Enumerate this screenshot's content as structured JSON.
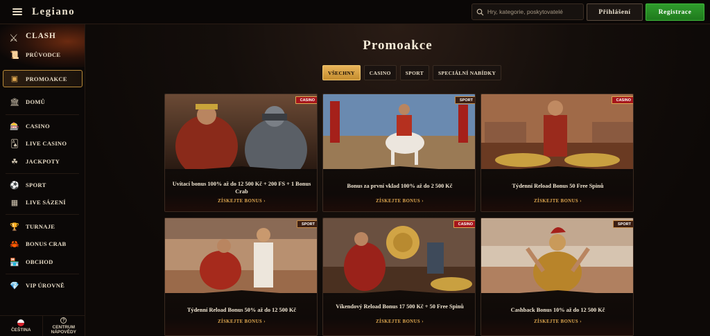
{
  "header": {
    "logo": "Legiano",
    "search_placeholder": "Hry, kategorie, poskytovatelé",
    "login_label": "Přihlášení",
    "register_label": "Registrace",
    "register_color": "#2a8f27"
  },
  "sidebar": {
    "clash_label": "CLASH",
    "items": [
      {
        "label": "PRŮVODCE",
        "icon": "scroll-icon"
      },
      {
        "label": "PROMOAKCE",
        "icon": "treasure-chest-icon",
        "active": true
      },
      {
        "label": "DOMŮ",
        "icon": "temple-icon"
      },
      {
        "label": "CASINO",
        "icon": "slot-machine-icon"
      },
      {
        "label": "LIVE CASINO",
        "icon": "cards-icon"
      },
      {
        "label": "JACKPOTY",
        "icon": "clover-icon"
      },
      {
        "label": "SPORT",
        "icon": "ball-icon"
      },
      {
        "label": "LIVE SÁZENÍ",
        "icon": "live-icon"
      },
      {
        "label": "TURNAJE",
        "icon": "trophy-icon"
      },
      {
        "label": "BONUS CRAB",
        "icon": "crab-icon"
      },
      {
        "label": "OBCHOD",
        "icon": "shop-icon"
      },
      {
        "label": "VIP ÚROVNĚ",
        "icon": "diamond-icon"
      }
    ],
    "footer": {
      "language": "ČEŠTINA",
      "help_line1": "CENTRUM",
      "help_line2": "NÁPOVĚDY"
    }
  },
  "main": {
    "title": "Promoakce",
    "tabs": [
      {
        "label": "VŠECHNY",
        "active": true
      },
      {
        "label": "CASINO"
      },
      {
        "label": "SPORT"
      },
      {
        "label": "SPECIÁLNÍ NABÍDKY"
      }
    ],
    "cards": [
      {
        "badge": "CASINO",
        "title": "Uvítací bonus 100% až do 12 500 Kč + 200 FS + 1 Bonus Crab",
        "cta": "ZÍSKEJTE BONUS"
      },
      {
        "badge": "SPORT",
        "title": "Bonus za první vklad 100% až do 2 500 Kč",
        "cta": "ZÍSKEJTE BONUS"
      },
      {
        "badge": "CASINO",
        "title": "Týdenní Reload Bonus 50 Free Spinů",
        "cta": "ZÍSKEJTE BONUS"
      },
      {
        "badge": "SPORT",
        "title": "Týdenní Reload Bonus 50% až do 12 500 Kč",
        "cta": "ZÍSKEJTE BONUS"
      },
      {
        "badge": "CASINO",
        "title": "Víkendový Reload Bonus 17 500 Kč + 50 Free Spinů",
        "cta": "ZÍSKEJTE BONUS"
      },
      {
        "badge": "SPORT",
        "title": "Cashback Bonus 10% až do 12 500 Kč",
        "cta": "ZÍSKEJTE BONUS"
      }
    ]
  },
  "colors": {
    "accent_gold": "#e0a850",
    "casino_badge": "#a5151b",
    "background": "#0d0907"
  }
}
